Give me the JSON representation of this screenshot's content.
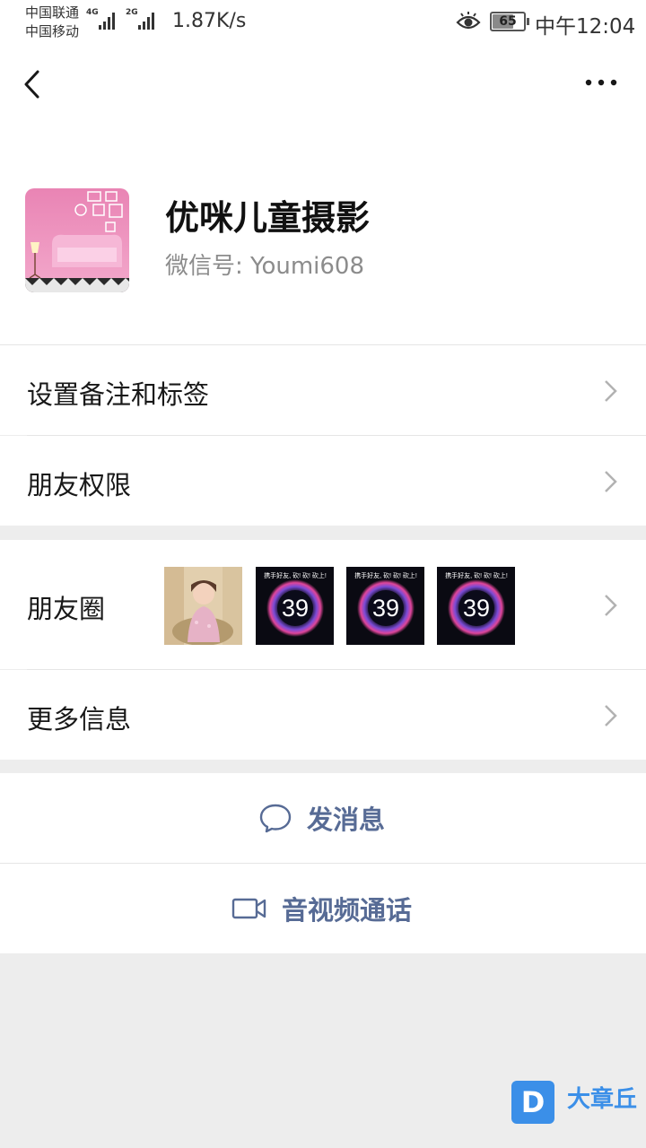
{
  "status_bar": {
    "carrier_1": "中国联通",
    "carrier_2": "中国移动",
    "signal_1_tag": "4G",
    "signal_2_tag": "2G",
    "net_speed": "1.87K/s",
    "battery": "65",
    "battery_level": 0.65,
    "time": "中午12:04"
  },
  "nav": {
    "back_icon": "chevron-left",
    "more_icon": "ellipsis"
  },
  "profile": {
    "name": "优咪儿童摄影",
    "wechat_id": "微信号: Youmi608"
  },
  "rows": {
    "remark_tags": "设置备注和标签",
    "friend_permissions": "朋友权限",
    "moments": "朋友圈",
    "more_info": "更多信息"
  },
  "moments_thumbs": {
    "promo_headline": "携手好友, 砍! 砍! 砍上!",
    "promo_number": "39"
  },
  "actions": {
    "send_message": "发消息",
    "video_call": "音视频通话"
  },
  "watermark": {
    "logo_letter": "D",
    "text": "大章丘"
  },
  "colors": {
    "link": "#576b95",
    "background": "#ededed"
  }
}
